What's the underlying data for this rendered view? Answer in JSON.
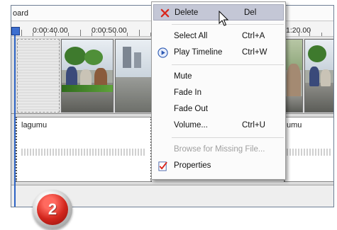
{
  "window": {
    "title_fragment": "oard"
  },
  "ruler": {
    "ticks": [
      "0:00:40.00",
      "0:00:50.00",
      "1:20.00"
    ]
  },
  "audio": {
    "clip_left_label": "lagumu",
    "clip_right_label": "umu"
  },
  "context_menu": {
    "items": [
      {
        "label": "Delete",
        "shortcut": "Del",
        "icon": "red-x-icon",
        "highlighted": true,
        "disabled": false
      },
      {
        "label": "Select All",
        "shortcut": "Ctrl+A",
        "disabled": false
      },
      {
        "label": "Play Timeline",
        "shortcut": "Ctrl+W",
        "icon": "play-circle-icon",
        "disabled": false
      },
      {
        "label": "Mute",
        "shortcut": "",
        "disabled": false
      },
      {
        "label": "Fade In",
        "shortcut": "",
        "disabled": false
      },
      {
        "label": "Fade Out",
        "shortcut": "",
        "disabled": false
      },
      {
        "label": "Volume...",
        "shortcut": "Ctrl+U",
        "disabled": false
      },
      {
        "label": "Browse for Missing File...",
        "shortcut": "",
        "disabled": true
      },
      {
        "label": "Properties",
        "shortcut": "",
        "icon": "properties-checklist-icon",
        "disabled": false
      }
    ]
  },
  "step_badge": {
    "number": "2"
  },
  "colors": {
    "menu_highlight": "#c4c7d6",
    "playhead": "#2c63c5",
    "badge_red": "#d2261d",
    "delete_x": "#d9261c"
  }
}
